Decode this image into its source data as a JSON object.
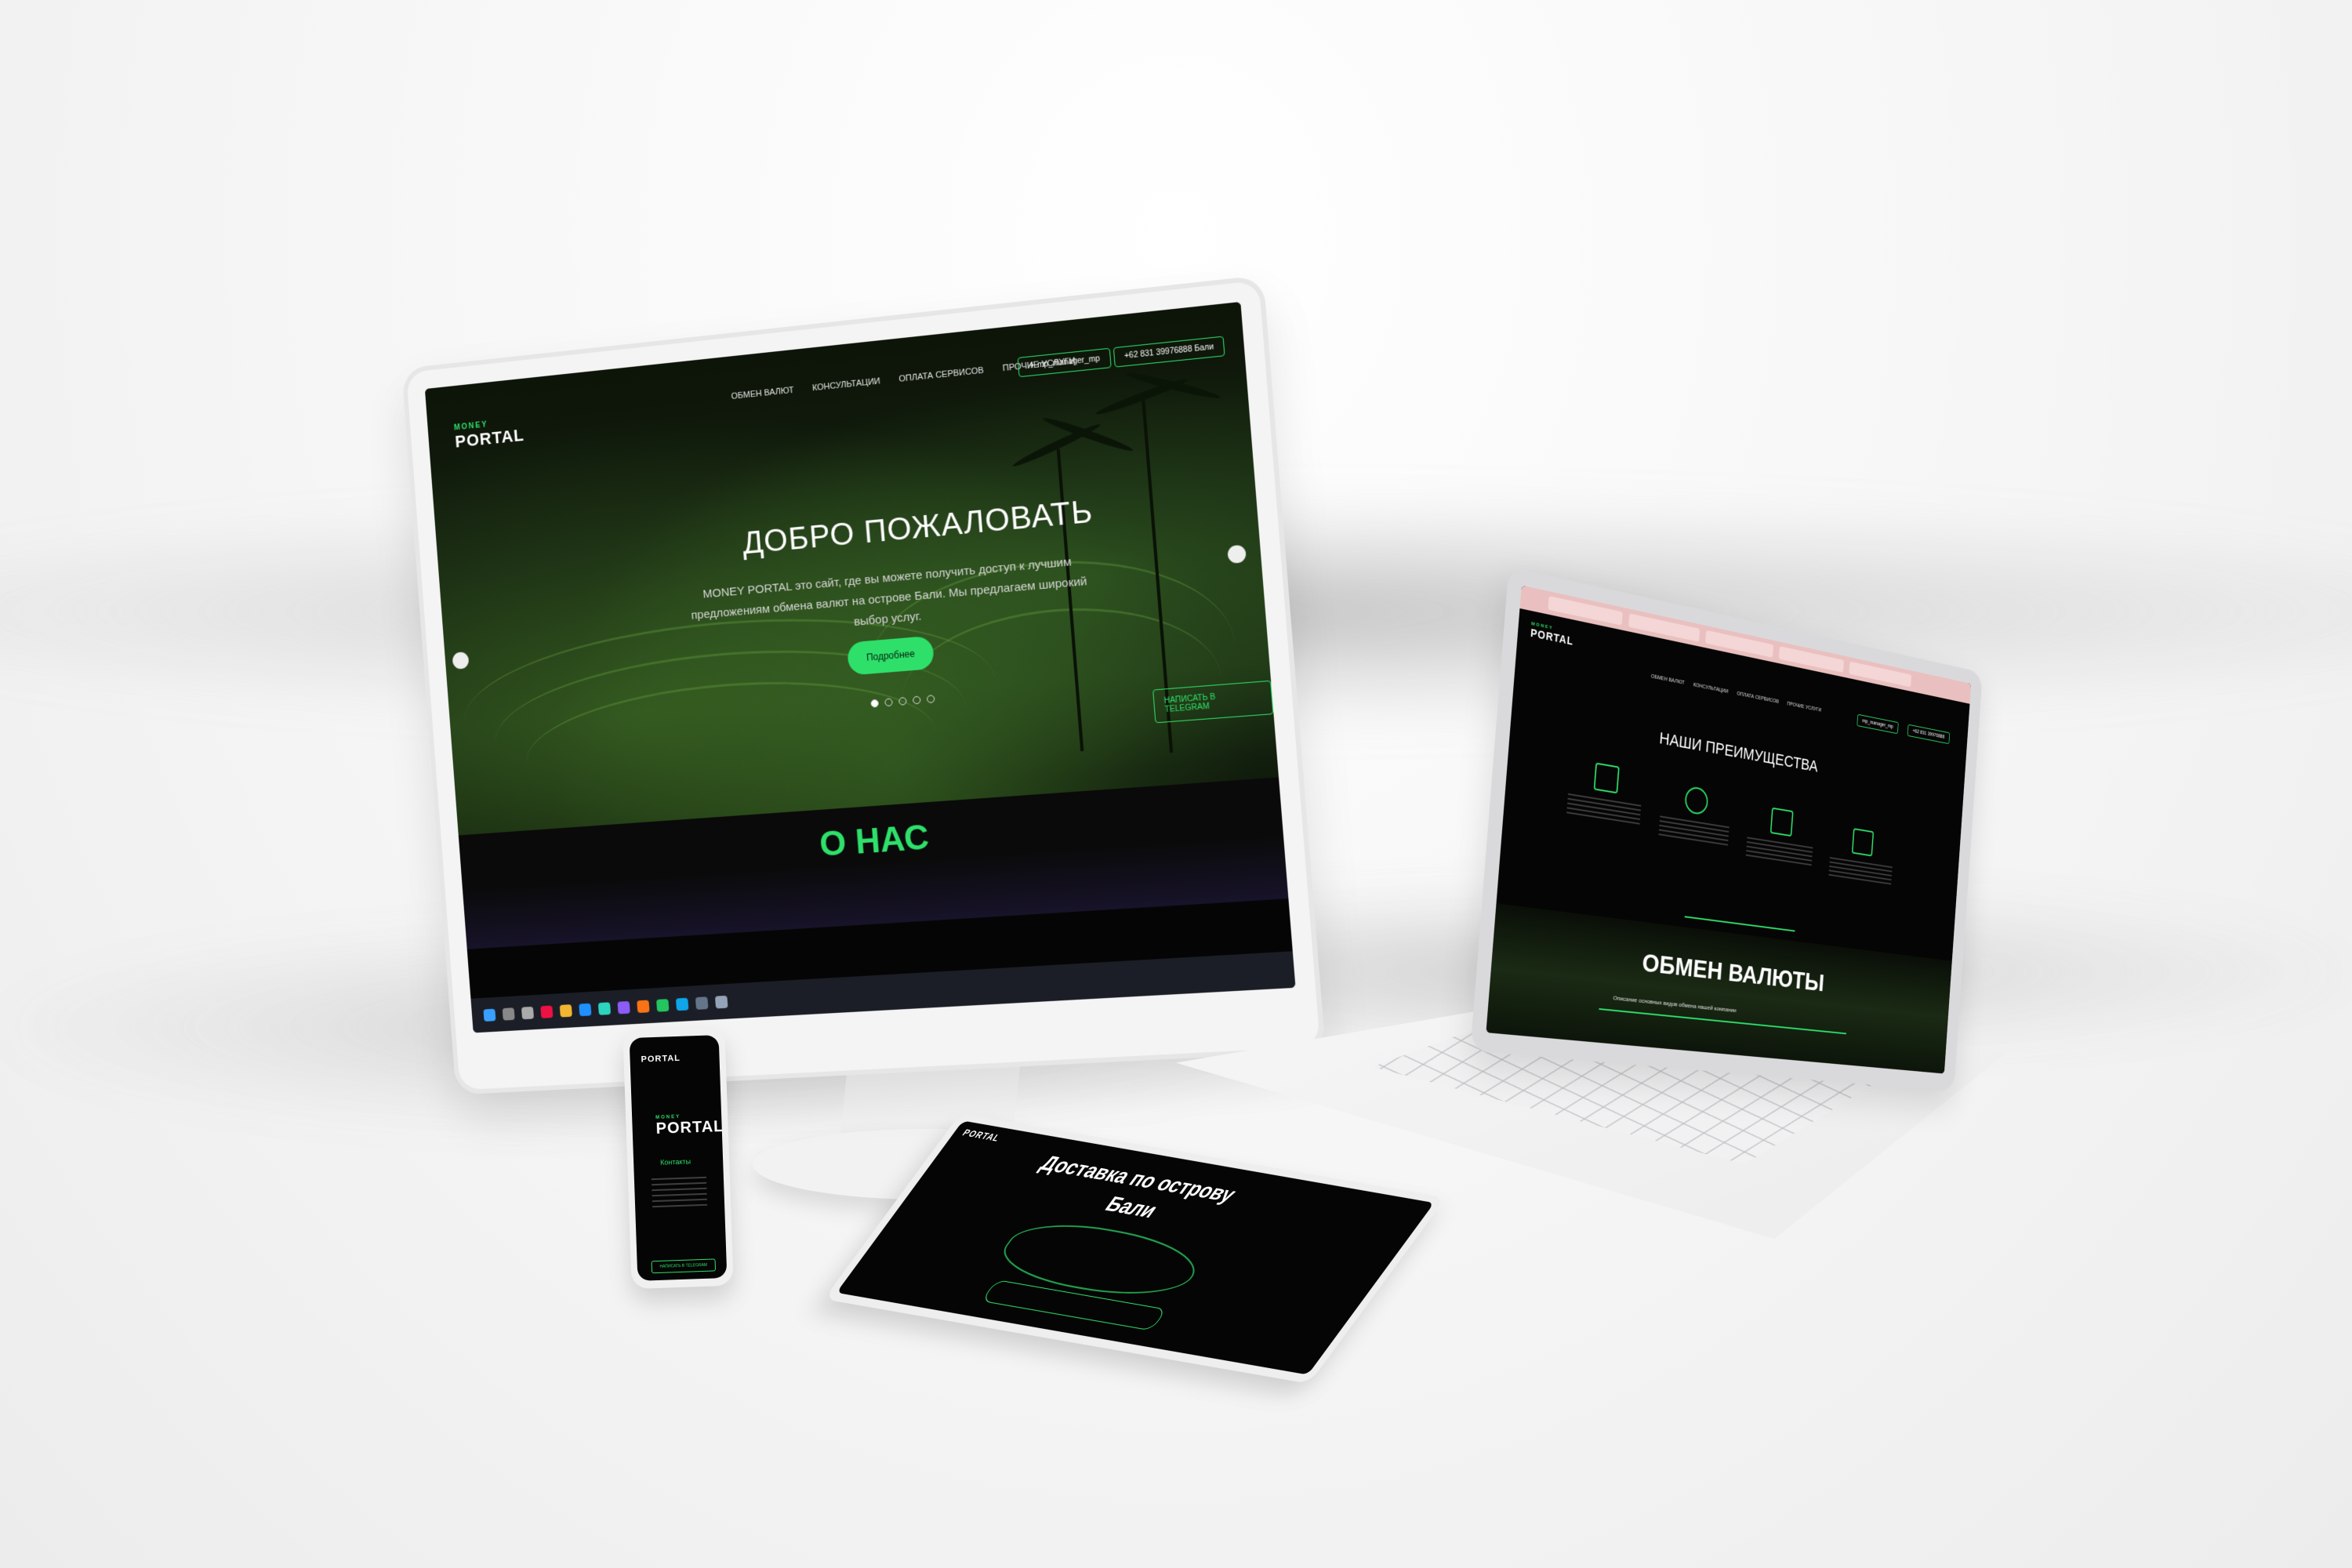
{
  "brand": {
    "logo_top": "MONEY",
    "logo_main": "PORTAL",
    "accent_color": "#2ee06a"
  },
  "desktop": {
    "menu": [
      "ОБМЕН ВАЛЮТ",
      "КОНСУЛЬТАЦИИ",
      "ОПЛАТА СЕРВИСОВ",
      "ПРОЧИЕ УСЛУГИ"
    ],
    "telegram_pill": "mp_manager_mp",
    "phone_pill": "+62 831 39976888",
    "phone_pill_suffix": "Бали",
    "hero_title": "ДОБРО ПОЖАЛОВАТЬ",
    "hero_text": "MONEY PORTAL это сайт, где вы можете получить доступ к лучшим предложениям обмена валют на острове Бали. Мы предлагаем широкий выбор услуг.",
    "hero_button": "Подробнее",
    "telegram_button": "НАПИСАТЬ В TELEGRAM",
    "about_title": "О НАС"
  },
  "laptop": {
    "advantages_title": "НАШИ ПРЕИМУЩЕСТВА",
    "exchange_title": "ОБМЕН ВАЛЮТЫ",
    "exchange_subtitle": "Описание основных видов обмена нашей компании"
  },
  "phone": {
    "contacts_title": "Контакты"
  },
  "tablet": {
    "title_line1": "Доставка по острову",
    "title_line2": "Бали"
  }
}
